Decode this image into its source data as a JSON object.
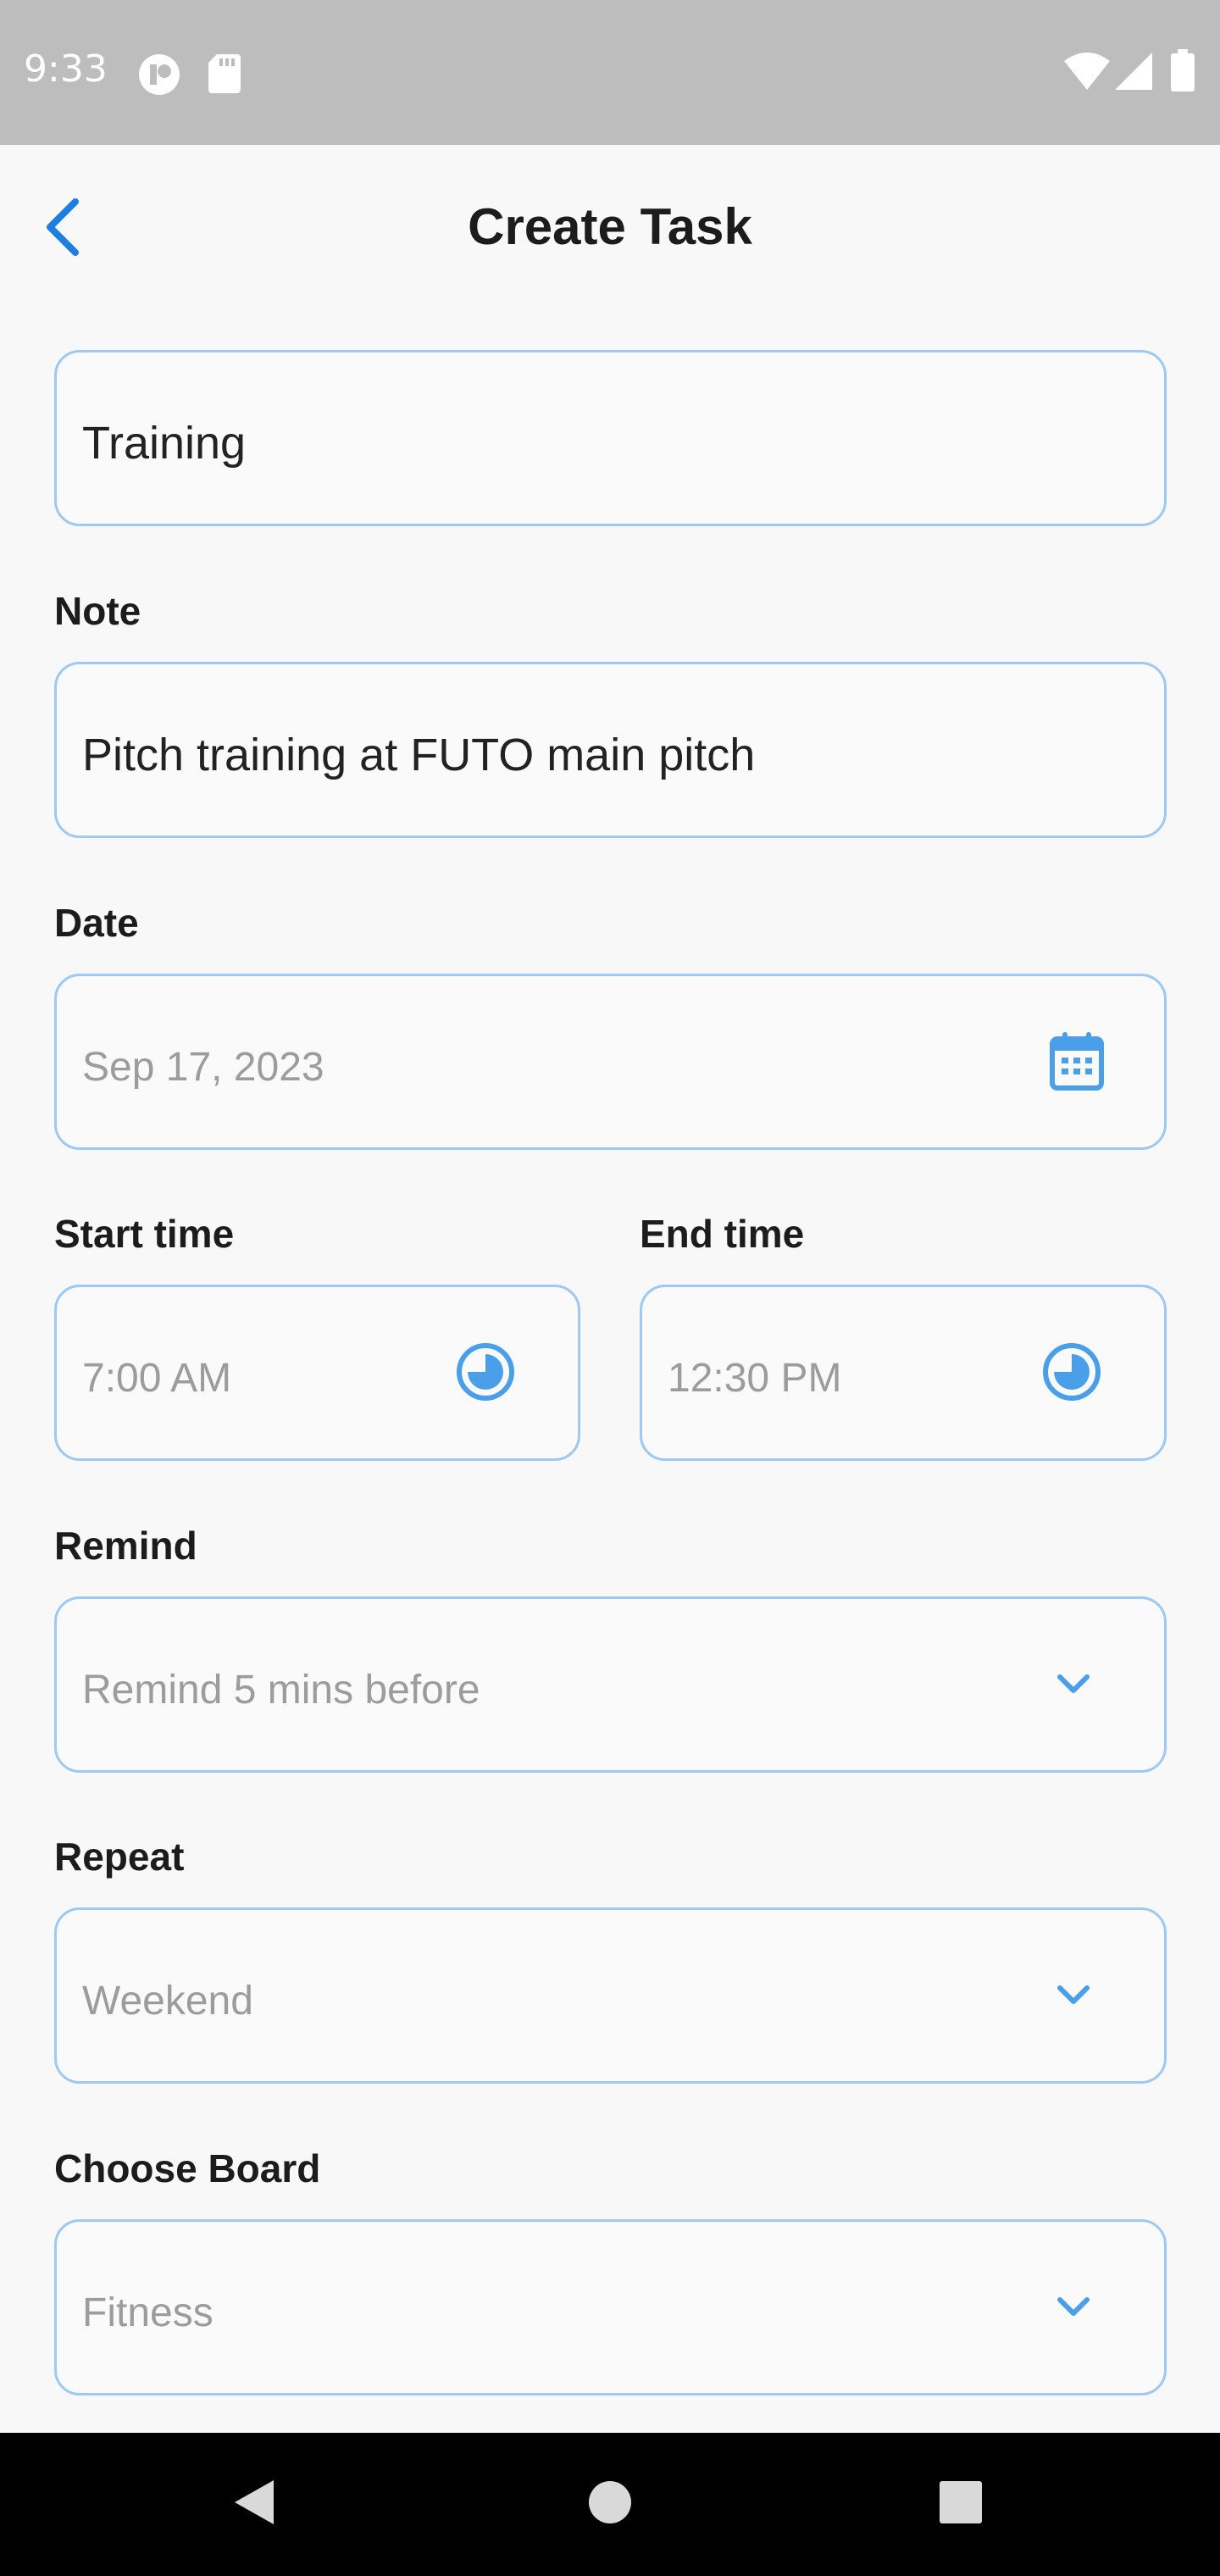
{
  "status_bar": {
    "time": "9:33",
    "left_icons": [
      "notification-app-icon",
      "sd-card-icon"
    ],
    "right_icons": [
      "wifi-icon",
      "cell-signal-icon",
      "battery-icon"
    ],
    "background": "#bdbdbd"
  },
  "header": {
    "title": "Create Task",
    "back_icon": "chevron-left-icon"
  },
  "form": {
    "title_field": {
      "value": "Training"
    },
    "note": {
      "label": "Note",
      "value": "Pitch training at FUTO main pitch"
    },
    "date": {
      "label": "Date",
      "value": "Sep 17, 2023",
      "icon": "calendar-icon"
    },
    "start_time": {
      "label": "Start time",
      "value": "7:00 AM",
      "icon": "clock-icon"
    },
    "end_time": {
      "label": "End time",
      "value": "12:30 PM",
      "icon": "clock-icon"
    },
    "remind": {
      "label": "Remind",
      "value": "Remind 5 mins before",
      "icon": "chevron-down-icon"
    },
    "repeat": {
      "label": "Repeat",
      "value": "Weekend",
      "icon": "chevron-down-icon"
    },
    "board": {
      "label": "Choose Board",
      "value": "Fitness",
      "icon": "chevron-down-icon"
    }
  },
  "nav_bar": {
    "buttons": [
      "back-triangle-icon",
      "home-circle-icon",
      "recents-square-icon"
    ]
  },
  "colors": {
    "accent": "#4a9fe8",
    "field_border": "#9dc9f2",
    "back_arrow": "#1f7fe0",
    "background": "#f8f8f8"
  }
}
